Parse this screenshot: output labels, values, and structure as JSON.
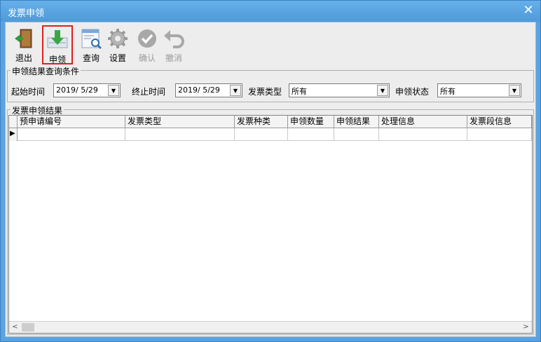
{
  "window": {
    "title": "发票申领",
    "close_glyph": "✕"
  },
  "toolbar": {
    "buttons": [
      {
        "label": "退出",
        "icon": "exit-door-icon",
        "enabled": true
      },
      {
        "label": "申领",
        "icon": "download-arrow-icon",
        "enabled": true,
        "highlighted": true
      },
      {
        "label": "查询",
        "icon": "search-document-icon",
        "enabled": true
      },
      {
        "label": "设置",
        "icon": "gear-icon",
        "enabled": true
      },
      {
        "label": "确认",
        "icon": "check-circle-icon",
        "enabled": false
      },
      {
        "label": "撤消",
        "icon": "undo-arrow-icon",
        "enabled": false
      }
    ]
  },
  "filter": {
    "group_title": "申领结果查询条件",
    "start_label": "起始时间",
    "start_value": "2019/ 5/29",
    "end_label": "终止时间",
    "end_value": "2019/ 5/29",
    "type_label": "发票类型",
    "type_value": "所有",
    "status_label": "申领状态",
    "status_value": "所有"
  },
  "results": {
    "group_title": "发票申领结果",
    "columns": [
      "预申请编号",
      "发票类型",
      "发票种类",
      "申领数量",
      "申领结果",
      "处理信息",
      "发票段信息"
    ],
    "row_marker": "▶"
  },
  "colors": {
    "titlebar": "#5aa3e0",
    "highlight_border": "#e02020"
  }
}
